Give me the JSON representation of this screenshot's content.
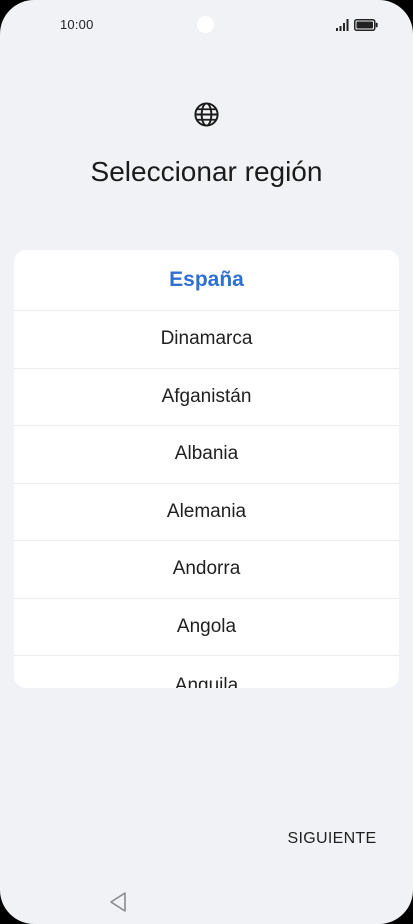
{
  "status_bar": {
    "time": "10:00",
    "icons": [
      "signal-icon",
      "battery-icon"
    ]
  },
  "header": {
    "icon": "globe-icon",
    "title": "Seleccionar región"
  },
  "region_list": {
    "selected": "España",
    "items": [
      "Dinamarca",
      "Afganistán",
      "Albania",
      "Alemania",
      "Andorra",
      "Angola",
      "Anguila"
    ]
  },
  "footer": {
    "next_label": "SIGUIENTE"
  },
  "nav": {
    "icons": [
      "back-icon"
    ]
  },
  "colors": {
    "background": "#f1f2f6",
    "card": "#ffffff",
    "accent": "#2f6fd2",
    "text": "#1f1f1f"
  }
}
